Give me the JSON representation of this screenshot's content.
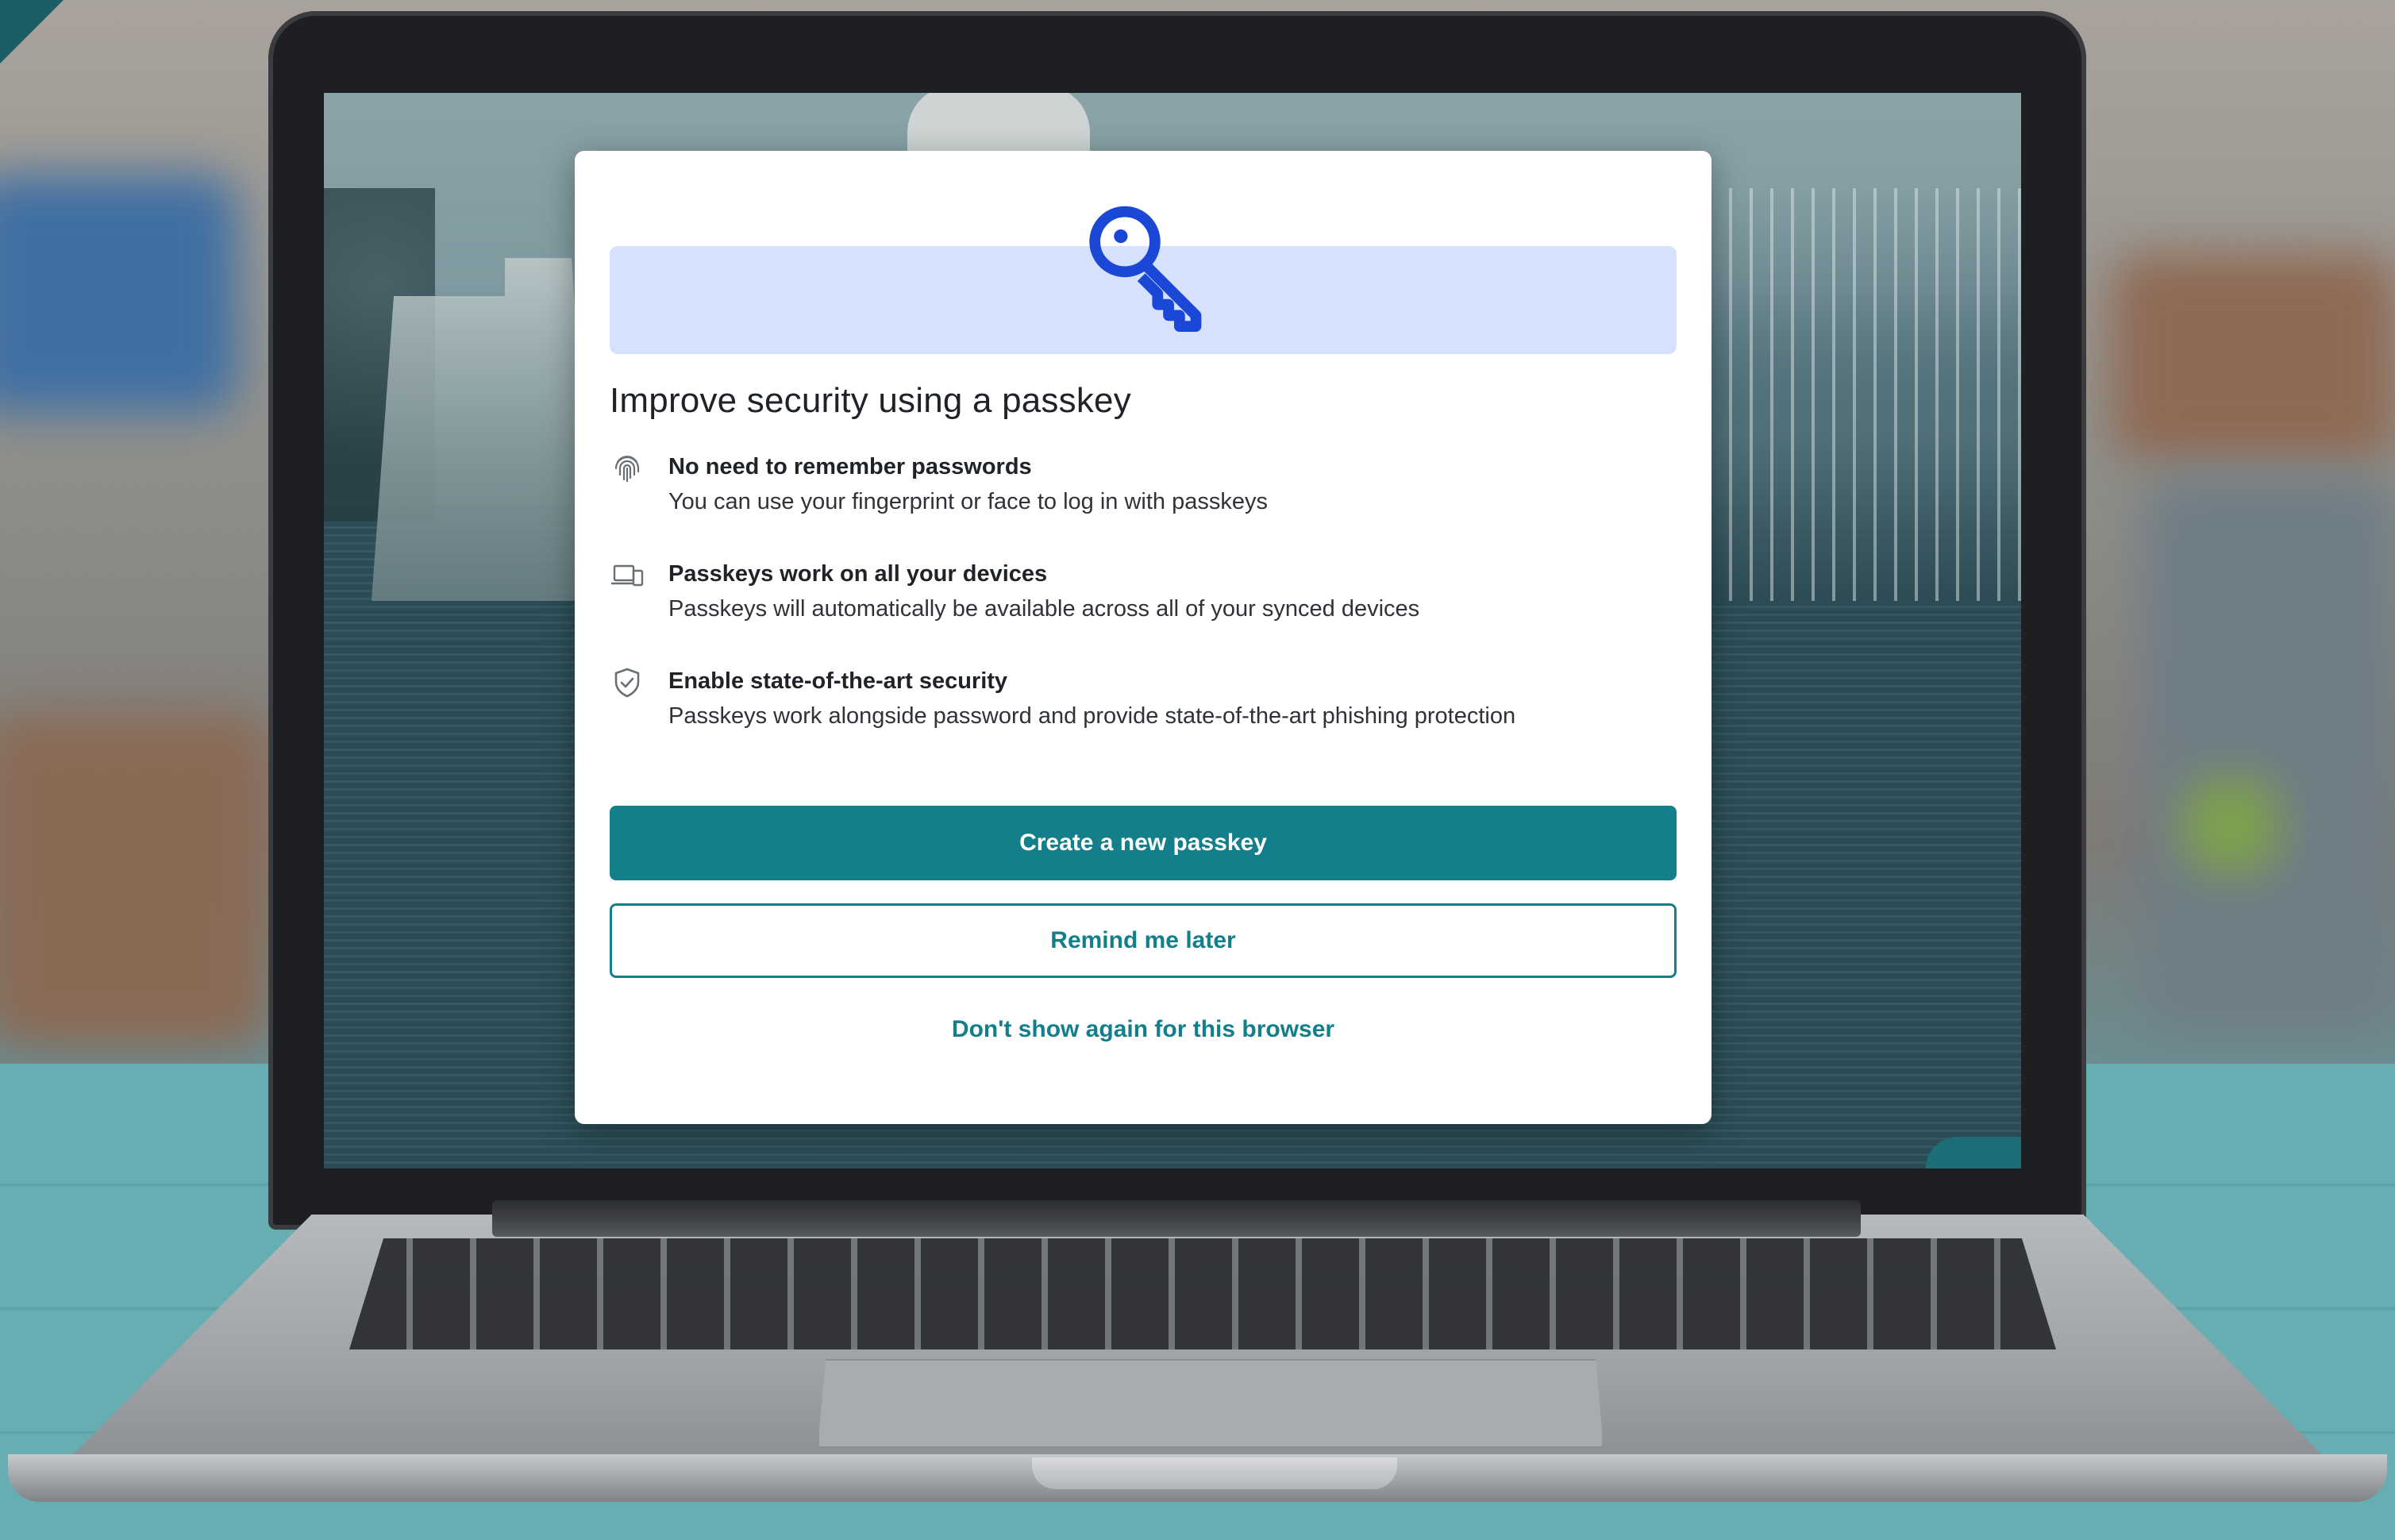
{
  "dialog": {
    "title": "Improve security using a passkey",
    "hero_icon": "key-icon",
    "features": [
      {
        "icon": "fingerprint-icon",
        "title": "No need to remember passwords",
        "description": "You can use your fingerprint or face to log in with passkeys"
      },
      {
        "icon": "devices-icon",
        "title": "Passkeys work on all your devices",
        "description": "Passkeys will automatically be available across all of your synced devices"
      },
      {
        "icon": "shield-check-icon",
        "title": "Enable state-of-the-art security",
        "description": "Passkeys work alongside password and provide state-of-the-art phishing protection"
      }
    ],
    "primary_button": "Create a new passkey",
    "secondary_button": "Remind me later",
    "link": "Don't show again for this browser"
  },
  "colors": {
    "accent": "#127f8b",
    "key_icon": "#1a47d6",
    "hero_background": "#d6e2fd",
    "text": "#1f2328"
  }
}
